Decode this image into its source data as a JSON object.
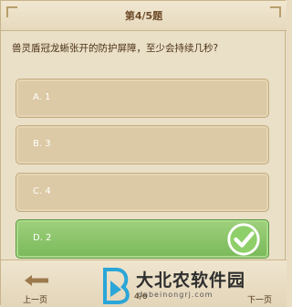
{
  "header": {
    "title": "第4/5题"
  },
  "question": {
    "text": "兽灵盾冠龙蜥张开的防护屏障，至少会持续几秒?"
  },
  "options": [
    {
      "label": "A. 1",
      "correct": false
    },
    {
      "label": "B. 3",
      "correct": false
    },
    {
      "label": "C. 4",
      "correct": false
    },
    {
      "label": "D. 2",
      "correct": true
    }
  ],
  "footer": {
    "prev_label": "上一页",
    "page_indicator": "4/6",
    "next_label": "下一页"
  },
  "watermark": {
    "text": "大北农软件园",
    "subtext": "dabeinongrj.com"
  },
  "colors": {
    "accent_correct": "#79b95a",
    "option_default": "#dcc9a5",
    "text_dark": "#4d3217"
  }
}
